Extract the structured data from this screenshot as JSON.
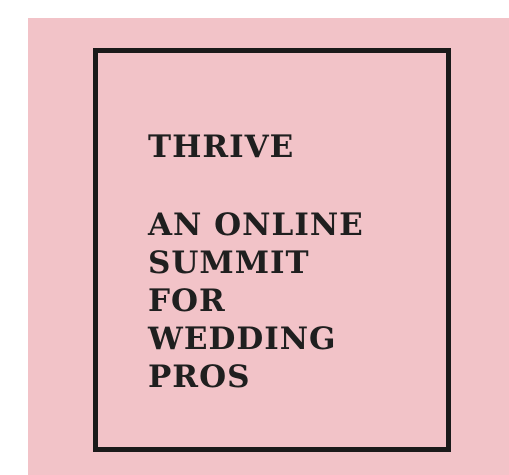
{
  "poster": {
    "title": "THRIVE",
    "subtitle_lines": [
      "AN ONLINE",
      "SUMMIT",
      "FOR",
      "WEDDING",
      "PROS"
    ],
    "background_color": "#f2c3c8",
    "frame_color": "#1a1a1a",
    "text_color": "#1f1f1f"
  }
}
